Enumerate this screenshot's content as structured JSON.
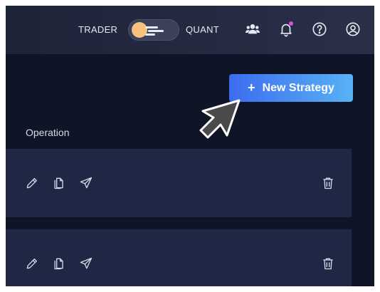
{
  "topbar": {
    "mode_left_label": "TRADER",
    "mode_right_label": "QUANT",
    "icons": [
      "users-icon",
      "bell-icon",
      "help-icon",
      "account-icon"
    ],
    "notification_dot_color": "#e04bd8"
  },
  "toolbar": {
    "new_strategy_label": "New Strategy",
    "new_strategy_icon": "plus-icon"
  },
  "table": {
    "operation_header": "Operation",
    "rows": [
      {
        "actions": [
          "edit-icon",
          "copy-icon",
          "send-icon"
        ],
        "delete": "trash-icon"
      },
      {
        "actions": [
          "edit-icon",
          "copy-icon",
          "send-icon"
        ],
        "delete": "trash-icon"
      }
    ]
  },
  "colors": {
    "topbar_bg": "#1d2438",
    "content_bg": "#0f1527",
    "row_bg": "#1f2744",
    "accent_start": "#3d6cf0",
    "accent_end": "#58b2f5"
  }
}
